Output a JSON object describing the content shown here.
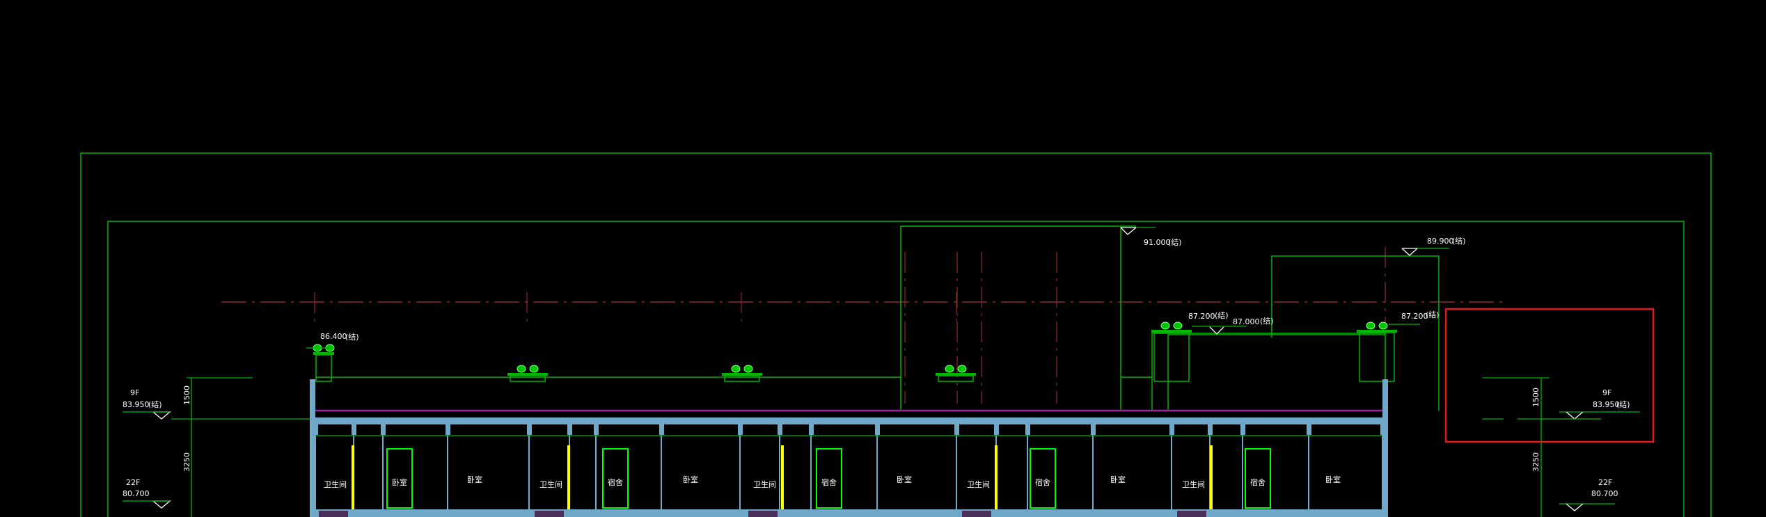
{
  "levels": {
    "l_86400": "86.400",
    "l_91000": "91.000",
    "l_89900": "89.900",
    "l_87200a": "87.200",
    "l_87000": "87.000",
    "l_87200b": "87.200",
    "left_9f_label": "9F",
    "left_9f_value": "83.950",
    "left_22f_label": "22F",
    "left_22f_value": "80.700",
    "right_9f_label": "9F",
    "right_9f_value": "83.950",
    "right_22f_label": "22F",
    "right_22f_value": "80.700",
    "tag": "(结)"
  },
  "dimensions": {
    "left_1500": "1500",
    "left_3250": "3250",
    "right_1500": "1500",
    "right_3250": "3250"
  },
  "rooms": [
    {
      "bath": "卫生间",
      "room": "卧室",
      "bed": "卧室"
    },
    {
      "bath": "卫生间",
      "room": "宿舍",
      "bed": "卧室"
    },
    {
      "bath": "卫生间",
      "room": "宿舍",
      "bed": "卧室"
    },
    {
      "bath": "卫生间",
      "room": "宿舍",
      "bed": "卧室"
    },
    {
      "bath": "卫生间",
      "room": "宿舍",
      "bed": "卧室"
    }
  ],
  "colors": {
    "line_green": "#00b400",
    "bright_green": "#00ff00",
    "wall_blue": "#6fa8c8",
    "axis_red": "#8b2a2a",
    "highlight_red": "#e0181c",
    "yellow": "#ffff00",
    "magenta": "#a020a0",
    "white": "#ffffff"
  }
}
